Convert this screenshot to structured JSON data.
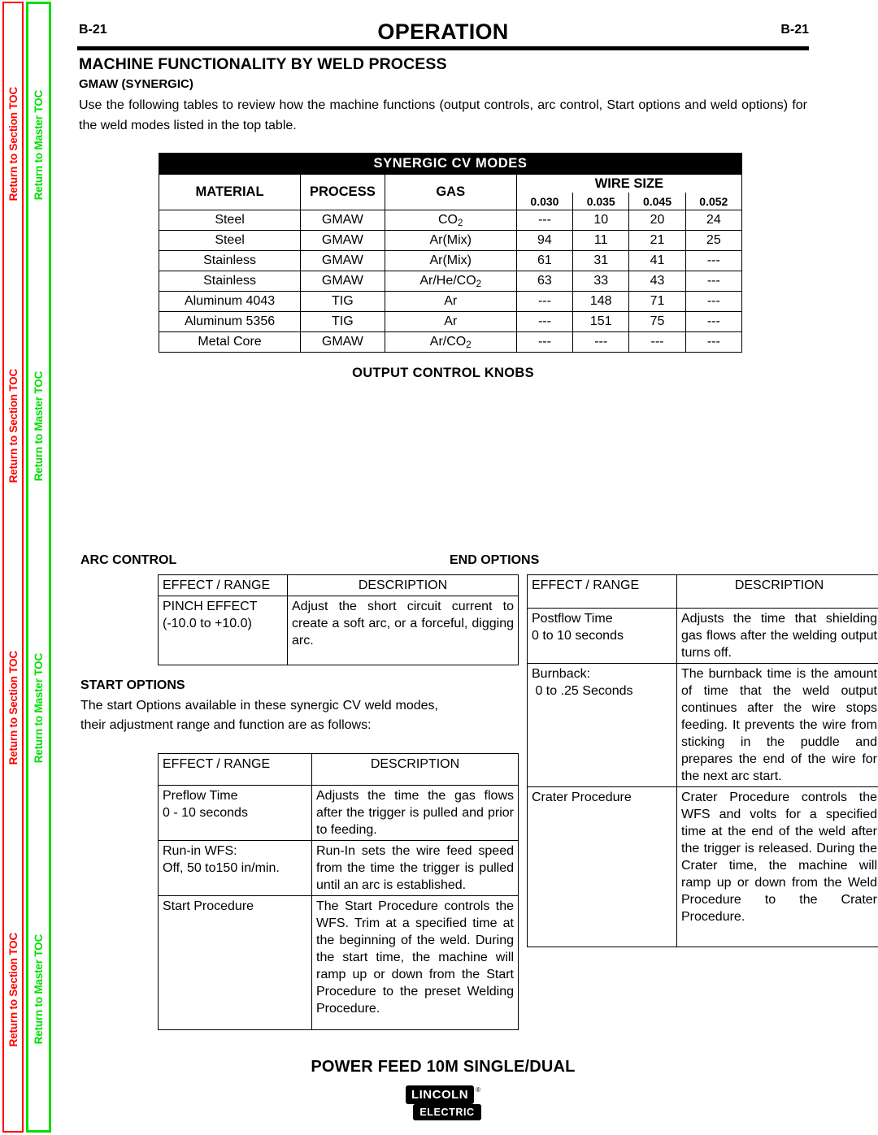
{
  "nav_rails": {
    "section_label": "Return to Section TOC",
    "master_label": "Return to Master TOC",
    "repeats": 4,
    "section_color": "#ff0000",
    "master_color": "#00e000"
  },
  "header": {
    "folio_left": "B-21",
    "folio_right": "B-21",
    "title": "OPERATION"
  },
  "section": {
    "title": "MACHINE FUNCTIONALITY BY WELD PROCESS",
    "subtitle": "GMAW (SYNERGIC)",
    "intro": "Use the following tables to review how the machine functions (output controls, arc control, Start options and weld options) for the weld modes listed in the top table."
  },
  "modes_table": {
    "banner": "SYNERGIC CV MODES",
    "headers": {
      "material": "MATERIAL",
      "process": "PROCESS",
      "gas": "GAS",
      "wire_size": "WIRE SIZE"
    },
    "wire_sizes": [
      "0.030",
      "0.035",
      "0.045",
      "0.052"
    ],
    "rows": [
      {
        "material": "Steel",
        "process": "GMAW",
        "gas_main": "CO",
        "gas_sub": "2",
        "gas_tail": "",
        "values": [
          "---",
          "10",
          "20",
          "24"
        ]
      },
      {
        "material": "Steel",
        "process": "GMAW",
        "gas_main": "Ar(Mix)",
        "gas_sub": "",
        "gas_tail": "",
        "values": [
          "94",
          "11",
          "21",
          "25"
        ]
      },
      {
        "material": "Stainless",
        "process": "GMAW",
        "gas_main": "Ar(Mix)",
        "gas_sub": "",
        "gas_tail": "",
        "values": [
          "61",
          "31",
          "41",
          "---"
        ]
      },
      {
        "material": "Stainless",
        "process": "GMAW",
        "gas_main": "Ar/He/CO",
        "gas_sub": "2",
        "gas_tail": "",
        "values": [
          "63",
          "33",
          "43",
          "---"
        ]
      },
      {
        "material": "Aluminum 4043",
        "process": "TIG",
        "gas_main": "Ar",
        "gas_sub": "",
        "gas_tail": "",
        "values": [
          "---",
          "148",
          "71",
          "---"
        ]
      },
      {
        "material": "Aluminum 5356",
        "process": "TIG",
        "gas_main": "Ar",
        "gas_sub": "",
        "gas_tail": "",
        "values": [
          "---",
          "151",
          "75",
          "---"
        ]
      },
      {
        "material": "Metal Core",
        "process": "GMAW",
        "gas_main": "Ar/CO",
        "gas_sub": "2",
        "gas_tail": "",
        "values": [
          "---",
          "---",
          "---",
          "---"
        ]
      }
    ]
  },
  "knobs_heading": "OUTPUT CONTROL KNOBS",
  "arc_control": {
    "heading": "ARC CONTROL",
    "col_effect": "EFFECT / RANGE",
    "col_description": "DESCRIPTION",
    "rows": [
      {
        "effect_line1": "PINCH EFFECT",
        "effect_line2": "(-10.0 to +10.0)",
        "description": "Adjust the short circuit current to create a soft arc, or a forceful, digging arc."
      }
    ]
  },
  "start_options": {
    "heading": "START OPTIONS",
    "intro": "The start Options available in  these synergic CV weld modes, their adjustment range and function are as follows:",
    "col_effect": "EFFECT / RANGE",
    "col_description": "DESCRIPTION",
    "rows": [
      {
        "effect_line1": "Preflow Time",
        "effect_line2": "0 - 10 seconds",
        "description": "Adjusts the time the gas flows after the trigger is pulled and prior to feeding."
      },
      {
        "effect_line1": "Run-in WFS:",
        "effect_line2": "Off, 50 to150 in/min.",
        "description": "Run-In sets the wire feed speed from the time the trigger is pulled until an arc is established."
      },
      {
        "effect_line1": "Start Procedure",
        "effect_line2": "",
        "description": "The Start Procedure controls the WFS. Trim at a specified time at the beginning of the weld. During the start time, the machine will ramp up or down from the Start Procedure to the preset Welding Procedure."
      }
    ]
  },
  "end_options": {
    "heading": "END  OPTIONS",
    "col_effect": "EFFECT / RANGE",
    "col_description": "DESCRIPTION",
    "rows": [
      {
        "effect_line1": "Postflow Time",
        "effect_line2": "0 to 10 seconds",
        "description": "Adjusts the time that shielding gas flows after the welding output turns off."
      },
      {
        "effect_line1": "Burnback:",
        "effect_line2": " 0 to .25 Seconds",
        "description": "The burnback time is the amount of time that the weld output continues after the wire stops feeding. It prevents the wire from sticking in the puddle and prepares the end of the wire for the next arc start."
      },
      {
        "effect_line1": "Crater Procedure",
        "effect_line2": "",
        "description": "Crater Procedure controls the WFS and volts for a specified time at the end of the weld after the trigger is released. During the Crater time, the machine will ramp up or down from the Weld Procedure to the Crater Procedure."
      }
    ]
  },
  "footer": {
    "title": "POWER FEED 10M SINGLE/DUAL",
    "logo_line1": "LINCOLN",
    "logo_registered": "®",
    "logo_line2": "ELECTRIC"
  }
}
